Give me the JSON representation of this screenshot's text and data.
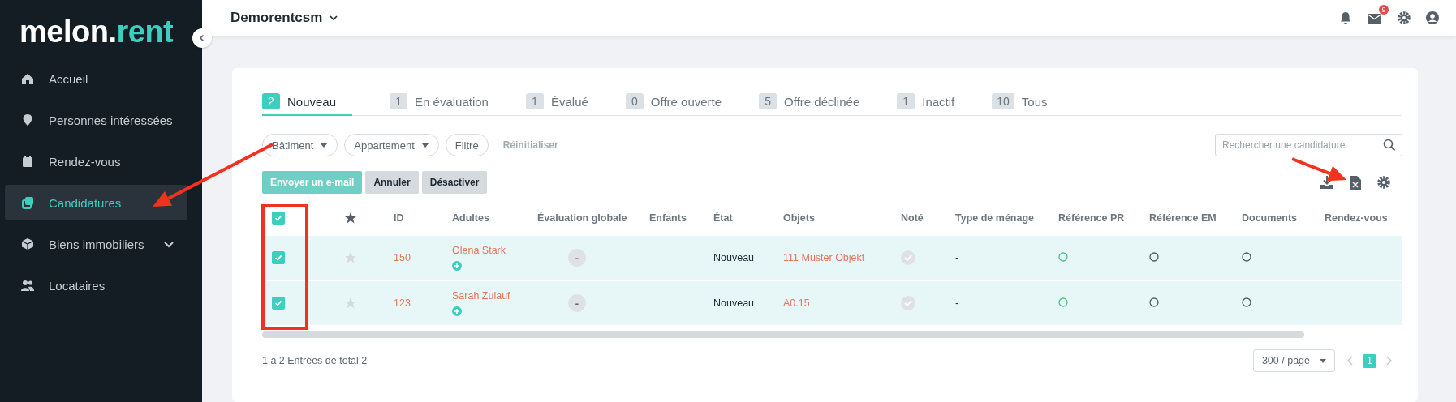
{
  "sidebar": {
    "logo": {
      "text": "melon.",
      "accent": "rent"
    },
    "items": [
      {
        "label": "Accueil",
        "selected": false
      },
      {
        "label": "Personnes intéressées",
        "selected": false
      },
      {
        "label": "Rendez-vous",
        "selected": false
      },
      {
        "label": "Candidatures",
        "selected": true
      },
      {
        "label": "Biens immobiliers",
        "selected": false,
        "expanded": false
      },
      {
        "label": "Locataires",
        "selected": false
      }
    ]
  },
  "topbar": {
    "workspace": "Demorentcsm",
    "mail_badge": "9"
  },
  "tabs": [
    {
      "count": "2",
      "label": "Nouveau",
      "selected": true
    },
    {
      "count": "1",
      "label": "En évaluation",
      "selected": false
    },
    {
      "count": "1",
      "label": "Évalué",
      "selected": false
    },
    {
      "count": "0",
      "label": "Offre ouverte",
      "selected": false
    },
    {
      "count": "5",
      "label": "Offre déclinée",
      "selected": false
    },
    {
      "count": "1",
      "label": "Inactif",
      "selected": false
    },
    {
      "count": "10",
      "label": "Tous",
      "selected": false
    }
  ],
  "filters": [
    {
      "label": "Bâtiment",
      "kind": "dropdown",
      "disabled": false
    },
    {
      "label": "Appartement",
      "kind": "dropdown",
      "disabled": false
    },
    {
      "label": "Filtre",
      "kind": "button",
      "disabled": false
    },
    {
      "label": "Réinitialiser",
      "kind": "link",
      "disabled": true
    }
  ],
  "search": {
    "placeholder": "Rechercher une candidature"
  },
  "actions": [
    {
      "label": "Envoyer un e-mail",
      "disabled": true
    },
    {
      "label": "Annuler",
      "disabled": false
    },
    {
      "label": "Désactiver",
      "disabled": false
    }
  ],
  "table": {
    "select_all_checked": true,
    "columns": [
      "ID",
      "Adultes",
      "Évaluation globale",
      "Enfants",
      "État",
      "Objets",
      "Noté",
      "Type de ménage",
      "Référence PR",
      "Référence EM",
      "Documents",
      "Rendez-vous"
    ],
    "rows": [
      {
        "checked": true,
        "starred": false,
        "id": "150",
        "adult": "Olena Stark",
        "evaluation": "-",
        "state": "Nouveau",
        "object": "111 Muster Objekt",
        "household": "-",
        "references": [
          {
            "color": "#4cc38a"
          },
          {
            "color": "#555b61"
          },
          {
            "color": "#555b61"
          }
        ]
      },
      {
        "checked": true,
        "starred": false,
        "id": "123",
        "adult": "Sarah Zulauf",
        "evaluation": "-",
        "state": "Nouveau",
        "object": "A0.15",
        "household": "-",
        "references": [
          {
            "color": "#4cc38a"
          },
          {
            "color": "#555b61"
          },
          {
            "color": "#555b61"
          }
        ]
      }
    ]
  },
  "footer": {
    "summary": "1 à 2 Entrées de total 2",
    "page_size": "300 / page",
    "pages": [
      {
        "label": "1",
        "selected": true
      }
    ]
  },
  "annotations": [
    {
      "kind": "arrow"
    },
    {
      "kind": "arrow"
    },
    {
      "kind": "highlight-box"
    }
  ]
}
